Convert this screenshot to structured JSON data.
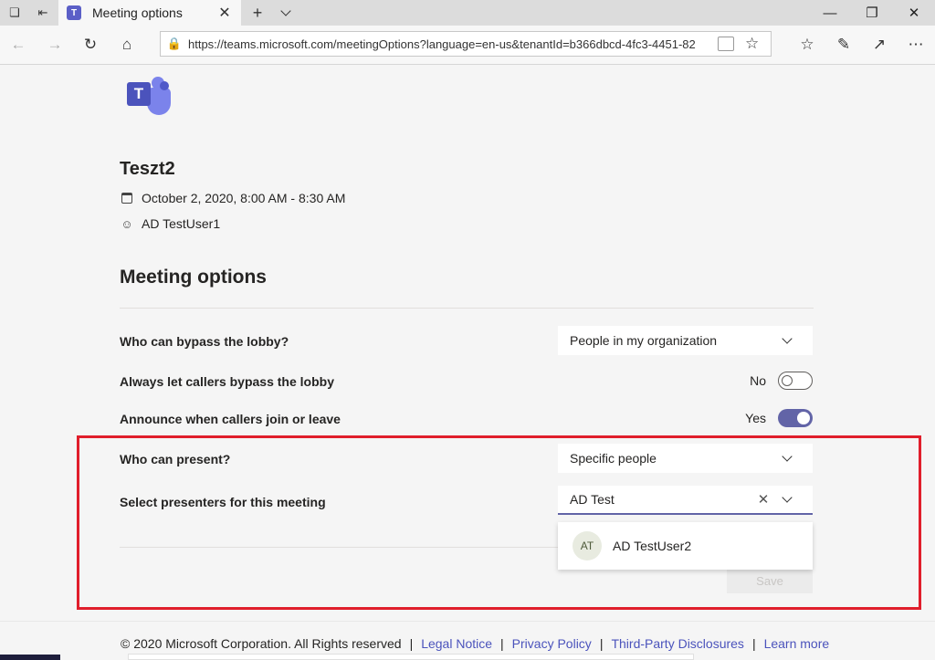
{
  "browser": {
    "tab_title": "Meeting options",
    "url": "https://teams.microsoft.com/meetingOptions?language=en-us&tenantId=b366dbcd-4fc3-4451-82"
  },
  "meeting": {
    "title": "Teszt2",
    "datetime": "October 2, 2020, 8:00 AM - 8:30 AM",
    "organizer": "AD TestUser1"
  },
  "options": {
    "section_title": "Meeting options",
    "bypass_lobby": {
      "label": "Who can bypass the lobby?",
      "value": "People in my organization"
    },
    "callers_bypass": {
      "label": "Always let callers bypass the lobby",
      "state_label": "No",
      "on": false
    },
    "announce": {
      "label": "Announce when callers join or leave",
      "state_label": "Yes",
      "on": true
    },
    "who_present": {
      "label": "Who can present?",
      "value": "Specific people"
    },
    "presenters": {
      "label": "Select presenters for this meeting",
      "input_value": "AD Test"
    },
    "suggestion": {
      "initials": "AT",
      "name": "AD TestUser2"
    },
    "save_label": "Save"
  },
  "footer": {
    "copyright": "© 2020 Microsoft Corporation. All Rights reserved",
    "links": [
      "Legal Notice",
      "Privacy Policy",
      "Third-Party Disclosures",
      "Learn more"
    ]
  },
  "colors": {
    "accent": "#6264a7",
    "highlight": "#e01e2b",
    "link": "#4b53bc"
  }
}
